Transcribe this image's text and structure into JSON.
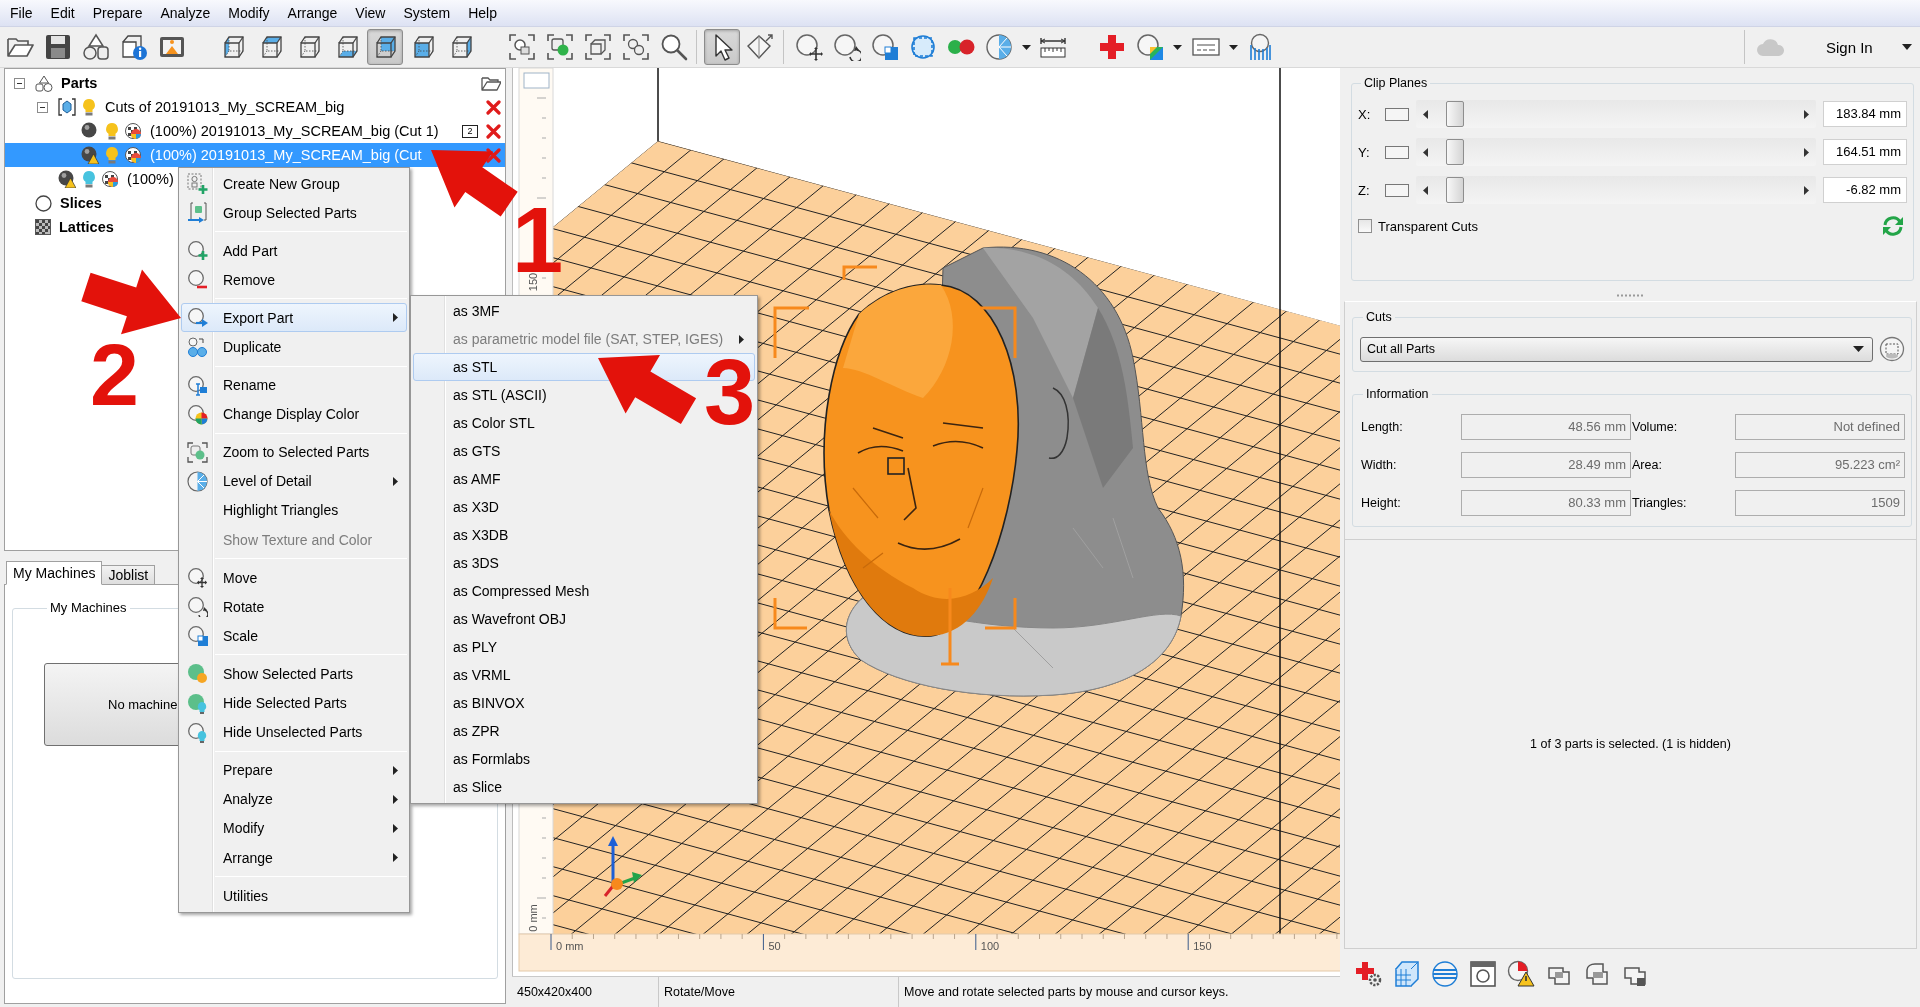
{
  "menu_bar": [
    "File",
    "Edit",
    "Prepare",
    "Analyze",
    "Modify",
    "Arrange",
    "View",
    "System",
    "Help"
  ],
  "toolbar": {
    "view_buttons": [
      {
        "selected": false
      },
      {
        "selected": false
      },
      {
        "selected": false
      },
      {
        "selected": false
      },
      {
        "selected": true
      },
      {
        "selected": false
      },
      {
        "selected": false
      }
    ],
    "mode_buttons": [
      {
        "selected": true
      },
      {
        "selected": false
      }
    ],
    "account": {
      "label": "Sign In"
    }
  },
  "parts_tree": [
    {
      "kind": "parts_root",
      "label": "Parts",
      "selected": false,
      "expanded": true,
      "removable": false,
      "children": [
        {
          "kind": "group",
          "label": "Cuts of 20191013_My_SCREAM_big",
          "selected": false,
          "expanded": true,
          "visible": true,
          "removable": true,
          "children": [
            {
              "kind": "part",
              "label": "(100%) 20191013_My_SCREAM_big (Cut 1)",
              "selected": false,
              "visible": true,
              "warning": false,
              "removable": true,
              "badge": "2"
            },
            {
              "kind": "part",
              "label": "(100%) 20191013_My_SCREAM_big (Cut",
              "selected": true,
              "visible": true,
              "warning": true,
              "removable": true
            }
          ]
        },
        {
          "kind": "part",
          "label": "(100%)",
          "selected": false,
          "visible": false,
          "warning": true,
          "removable": false
        }
      ]
    },
    {
      "kind": "slices_root",
      "label": "Slices",
      "selected": false,
      "removable": false
    },
    {
      "kind": "lattices_root",
      "label": "Lattices",
      "selected": false,
      "removable": false
    }
  ],
  "machines_panel": {
    "tabs": [
      {
        "label": "My Machines",
        "selected": true
      },
      {
        "label": "Joblist",
        "selected": false
      }
    ],
    "group_title": "My Machines",
    "machine_button": "No machine"
  },
  "context_menu": {
    "sections": [
      [
        {
          "label": "Create New Group",
          "selected": false,
          "disabled": false,
          "submenu": false
        },
        {
          "label": "Group Selected Parts",
          "selected": false,
          "disabled": false,
          "submenu": false
        }
      ],
      [
        {
          "label": "Add Part",
          "selected": false,
          "disabled": false,
          "submenu": false
        },
        {
          "label": "Remove",
          "selected": false,
          "disabled": false,
          "submenu": false
        }
      ],
      [
        {
          "label": "Export Part",
          "selected": true,
          "disabled": false,
          "submenu": true
        },
        {
          "label": "Duplicate",
          "selected": false,
          "disabled": false,
          "submenu": false
        }
      ],
      [
        {
          "label": "Rename",
          "selected": false,
          "disabled": false,
          "submenu": false
        },
        {
          "label": "Change Display Color",
          "selected": false,
          "disabled": false,
          "submenu": false
        }
      ],
      [
        {
          "label": "Zoom to Selected Parts",
          "selected": false,
          "disabled": false,
          "submenu": false
        },
        {
          "label": "Level of Detail",
          "selected": false,
          "disabled": false,
          "submenu": true
        },
        {
          "label": "Highlight Triangles",
          "selected": false,
          "disabled": false,
          "submenu": false
        },
        {
          "label": "Show Texture and Color",
          "selected": false,
          "disabled": true,
          "submenu": false
        }
      ],
      [
        {
          "label": "Move",
          "selected": false,
          "disabled": false,
          "submenu": false
        },
        {
          "label": "Rotate",
          "selected": false,
          "disabled": false,
          "submenu": false
        },
        {
          "label": "Scale",
          "selected": false,
          "disabled": false,
          "submenu": false
        }
      ],
      [
        {
          "label": "Show Selected Parts",
          "selected": false,
          "disabled": false,
          "submenu": false
        },
        {
          "label": "Hide Selected Parts",
          "selected": false,
          "disabled": false,
          "submenu": false
        },
        {
          "label": "Hide Unselected Parts",
          "selected": false,
          "disabled": false,
          "submenu": false
        }
      ],
      [
        {
          "label": "Prepare",
          "selected": false,
          "disabled": false,
          "submenu": true
        },
        {
          "label": "Analyze",
          "selected": false,
          "disabled": false,
          "submenu": true
        },
        {
          "label": "Modify",
          "selected": false,
          "disabled": false,
          "submenu": true
        },
        {
          "label": "Arrange",
          "selected": false,
          "disabled": false,
          "submenu": true
        }
      ],
      [
        {
          "label": "Utilities",
          "selected": false,
          "disabled": false,
          "submenu": false
        }
      ]
    ]
  },
  "export_submenu": {
    "items": [
      {
        "label": "as 3MF",
        "selected": false,
        "disabled": false,
        "submenu": false
      },
      {
        "label": "as parametric model file (SAT, STEP, IGES)",
        "selected": false,
        "disabled": true,
        "submenu": true
      },
      {
        "label": "as STL",
        "selected": true,
        "disabled": false,
        "submenu": false
      },
      {
        "label": "as STL (ASCII)",
        "selected": false,
        "disabled": false,
        "submenu": false
      },
      {
        "label": "as Color STL",
        "selected": false,
        "disabled": false,
        "submenu": false
      },
      {
        "label": "as GTS",
        "selected": false,
        "disabled": false,
        "submenu": false
      },
      {
        "label": "as AMF",
        "selected": false,
        "disabled": false,
        "submenu": false
      },
      {
        "label": "as X3D",
        "selected": false,
        "disabled": false,
        "submenu": false
      },
      {
        "label": "as X3DB",
        "selected": false,
        "disabled": false,
        "submenu": false
      },
      {
        "label": "as 3DS",
        "selected": false,
        "disabled": false,
        "submenu": false
      },
      {
        "label": "as Compressed Mesh",
        "selected": false,
        "disabled": false,
        "submenu": false
      },
      {
        "label": "as Wavefront OBJ",
        "selected": false,
        "disabled": false,
        "submenu": false
      },
      {
        "label": "as PLY",
        "selected": false,
        "disabled": false,
        "submenu": false
      },
      {
        "label": "as VRML",
        "selected": false,
        "disabled": false,
        "submenu": false
      },
      {
        "label": "as BINVOX",
        "selected": false,
        "disabled": false,
        "submenu": false
      },
      {
        "label": "as ZPR",
        "selected": false,
        "disabled": false,
        "submenu": false
      },
      {
        "label": "as Formlabs",
        "selected": false,
        "disabled": false,
        "submenu": false
      },
      {
        "label": "as Slice",
        "selected": false,
        "disabled": false,
        "submenu": false
      }
    ]
  },
  "viewport": {
    "vertical_ruler": [
      "150",
      "0 mm"
    ],
    "horizontal_ruler": [
      "0 mm",
      "50",
      "100",
      "150"
    ]
  },
  "status_bar": [
    "450x420x400",
    "Rotate/Move",
    "Move and rotate selected parts by mouse and cursor keys."
  ],
  "clip_planes": {
    "title": "Clip Planes",
    "planes": [
      {
        "axis": "X:",
        "level": 0.04,
        "value": "183.84 mm"
      },
      {
        "axis": "Y:",
        "level": 0.04,
        "value": "164.51 mm"
      },
      {
        "axis": "Z:",
        "level": 0.04,
        "value": "-6.82 mm"
      }
    ],
    "transparent_cuts": {
      "label": "Transparent Cuts",
      "checked": false
    }
  },
  "cuts": {
    "title": "Cuts",
    "mode": "Cut all Parts"
  },
  "information": {
    "title": "Information",
    "fields": [
      {
        "label": "Length:",
        "value": "48.56 mm"
      },
      {
        "label": "Volume:",
        "value": "Not defined"
      },
      {
        "label": "Width:",
        "value": "28.49 mm"
      },
      {
        "label": "Area:",
        "value": "95.223 cm²"
      },
      {
        "label": "Height:",
        "value": "80.33 mm"
      },
      {
        "label": "Triangles:",
        "value": "1509"
      }
    ]
  },
  "selection_summary": "1 of 3 parts is selected. (1 is hidden)",
  "annotations": [
    {
      "number": "1"
    },
    {
      "number": "2"
    },
    {
      "number": "3"
    }
  ]
}
